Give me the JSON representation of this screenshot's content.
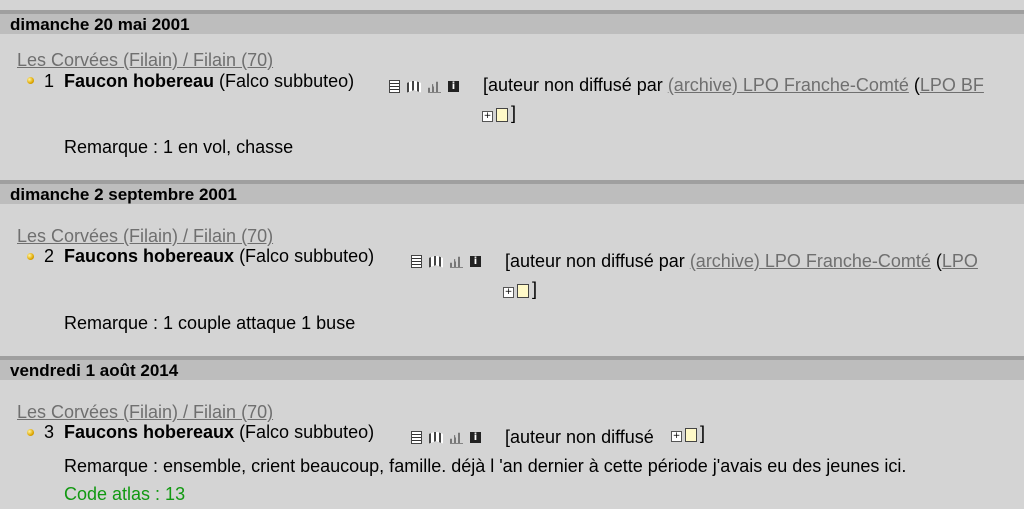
{
  "entries": [
    {
      "date": "dimanche 20 mai 2001",
      "location": "Les Corvées (Filain) / Filain (70)",
      "num": "1",
      "species_name": "Faucon hobereau",
      "species_latin": "(Falco subbuteo)",
      "author_prefix": "[auteur non diffusé par ",
      "archive_link": "(archive) LPO Franche-Comté",
      "org_prefix": " (",
      "org_link": "LPO BF",
      "closing_bracket": "]",
      "remark": "Remarque : 1 en vol, chasse"
    },
    {
      "date": "dimanche 2 septembre 2001",
      "location": "Les Corvées (Filain) / Filain (70)",
      "num": "2",
      "species_name": "Faucons hobereaux",
      "species_latin": "(Falco subbuteo)",
      "author_prefix": "[auteur non diffusé par ",
      "archive_link": "(archive) LPO Franche-Comté",
      "org_prefix": " (",
      "org_link": "LPO",
      "closing_bracket": "]",
      "remark": "Remarque : 1 couple attaque 1 buse"
    },
    {
      "date": "vendredi 1 août 2014",
      "location": "Les Corvées (Filain) / Filain (70)",
      "num": "3",
      "species_name": "Faucons hobereaux",
      "species_latin": "(Falco subbuteo)",
      "author_text": "[auteur non diffusé",
      "closing_bracket": "]",
      "remark": "Remarque : ensemble, crient beaucoup, famille. déjà l 'an dernier à cette période j'avais eu des jeunes ici.",
      "atlas": "Code atlas : 13"
    }
  ],
  "icons": [
    "list-icon",
    "map-icon",
    "chart-icon",
    "info-icon",
    "expand-icon",
    "note-icon"
  ],
  "colors": {
    "header_bg": "#bdbdbd",
    "body_bg": "#d4d4d4",
    "link": "#6f6f6f",
    "atlas": "#119911"
  }
}
